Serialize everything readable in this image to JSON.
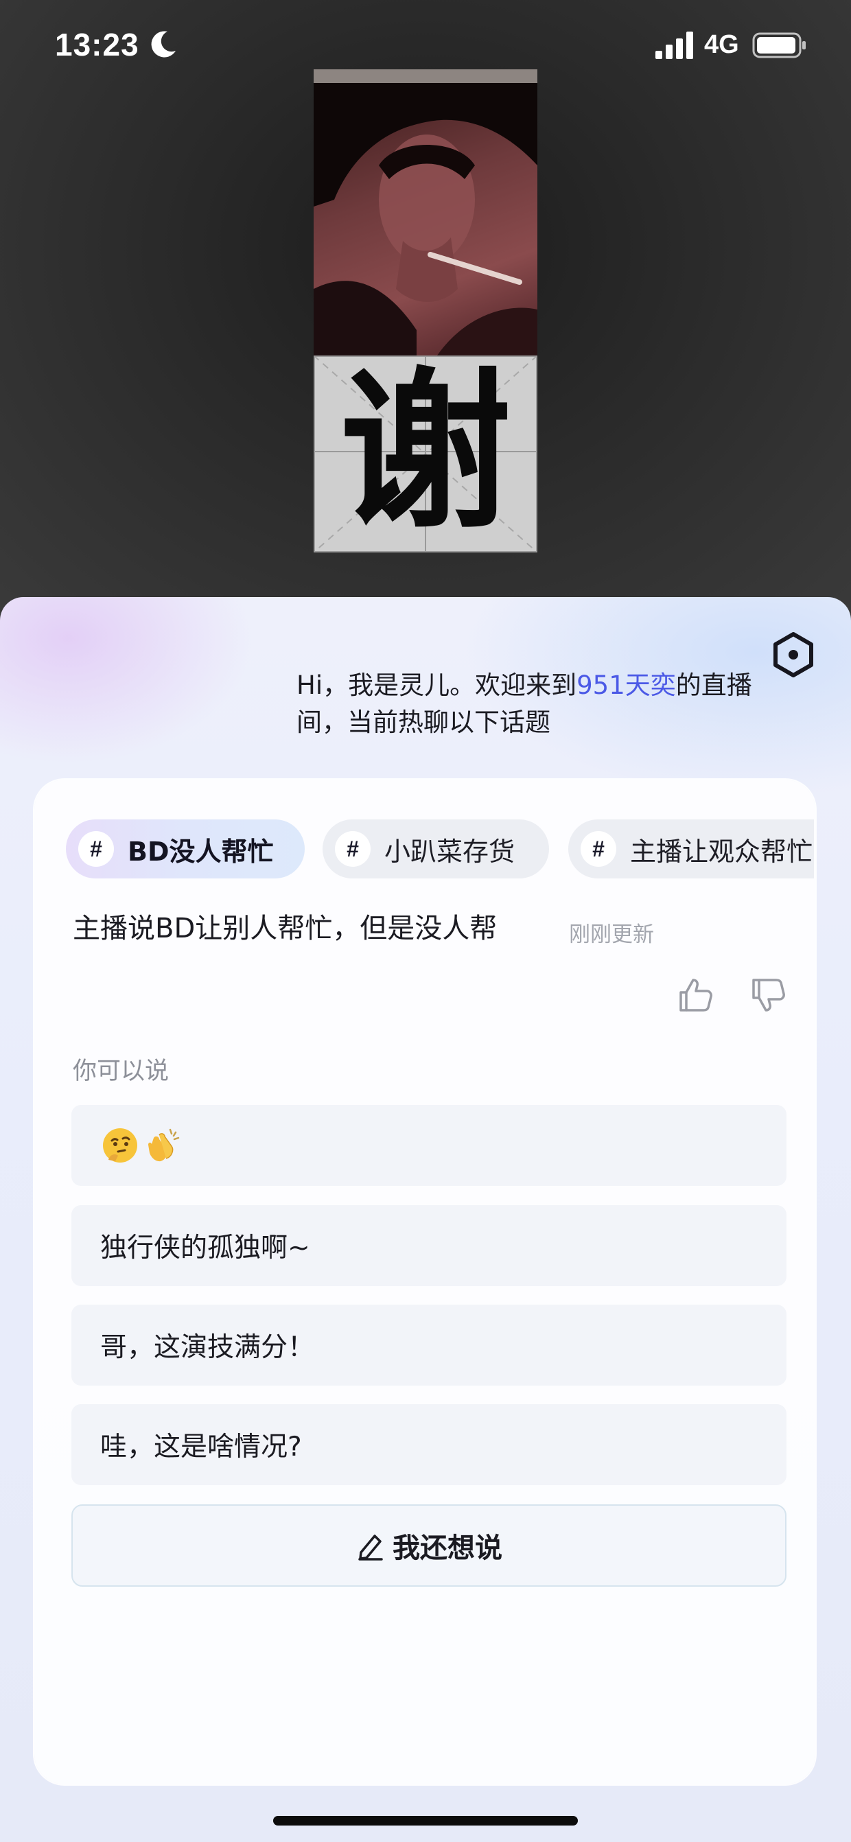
{
  "status_bar": {
    "time": "13:23",
    "network": "4G",
    "icons": [
      "moon-icon",
      "signal-icon",
      "battery-icon"
    ]
  },
  "poster": {
    "character": "谢"
  },
  "assistant": {
    "icon": "hexagon-assistant-icon",
    "greeting_prefix": "Hi，我是灵儿。欢迎来到",
    "greeting_highlight": "951天奕",
    "greeting_suffix": "的直播间，当前热聊以下话题",
    "highlight_color": "#4b59e6"
  },
  "topics": {
    "chips": [
      {
        "label": "BD没人帮忙",
        "active": true
      },
      {
        "label": "小趴菜存货",
        "active": false
      },
      {
        "label": "主播让观众帮忙",
        "active": false
      }
    ],
    "description": "主播说BD让别人帮忙，但是没人帮",
    "updated": "刚刚更新"
  },
  "feedback": {
    "icons": [
      "thumb-up-icon",
      "thumb-down-icon"
    ]
  },
  "suggestions": {
    "heading": "你可以说",
    "items": [
      {
        "type": "emoji",
        "emojis": [
          "thinking-face-emoji",
          "clapping-hands-emoji"
        ]
      },
      {
        "type": "text",
        "text": "独行侠的孤独啊~"
      },
      {
        "type": "text",
        "text": "哥，这演技满分！"
      },
      {
        "type": "text",
        "text": "哇，这是啥情况?"
      }
    ],
    "more_button": "我还想说"
  }
}
